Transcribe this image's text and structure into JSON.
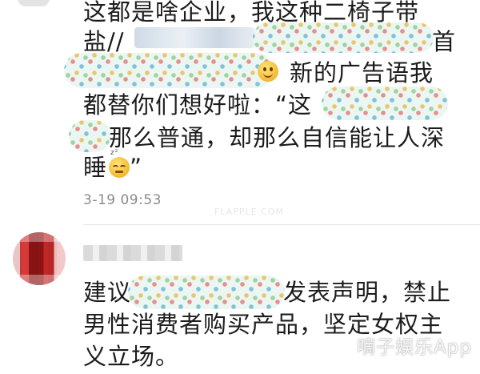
{
  "comment_1": {
    "lines": [
      "这都是啥企业，我这种二椅子带",
      "盐//",
      "首",
      "新的广告语我",
      "都替你们想好啦：“这",
      "那么普通，却那么自信能让人深",
      "睡"
    ],
    "closing_quote": "”",
    "emoji_1": "smile-emoji",
    "emoji_2": "sleepy-emoji",
    "emoji_2_zz": "z²",
    "timestamp": "3-19 09:53"
  },
  "comment_2": {
    "lines": [
      "建议",
      "发表声明，禁止",
      "男性消费者购买产品，坚定女权主",
      "义立场。"
    ]
  },
  "watermark": {
    "text": "嘀子娱乐App",
    "faint_text": "FLAPPLE.COM"
  },
  "colors": {
    "text": "#1c1c1c",
    "timestamp": "#8a8a8a",
    "divider": "#e6e6e6",
    "background": "#ffffff"
  }
}
